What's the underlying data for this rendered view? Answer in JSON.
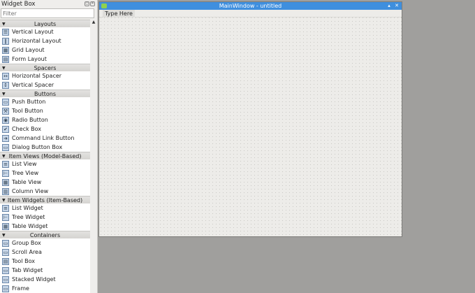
{
  "widget_box": {
    "title": "Widget Box",
    "filter_placeholder": "Filter",
    "sections": [
      {
        "label": "Layouts",
        "items": [
          "Vertical Layout",
          "Horizontal Layout",
          "Grid Layout",
          "Form Layout"
        ]
      },
      {
        "label": "Spacers",
        "items": [
          "Horizontal Spacer",
          "Vertical Spacer"
        ]
      },
      {
        "label": "Buttons",
        "items": [
          "Push Button",
          "Tool Button",
          "Radio Button",
          "Check Box",
          "Command Link Button",
          "Dialog Button Box"
        ]
      },
      {
        "label": "Item Views (Model-Based)",
        "items": [
          "List View",
          "Tree View",
          "Table View",
          "Column View"
        ]
      },
      {
        "label": "Item Widgets (Item-Based)",
        "items": [
          "List Widget",
          "Tree Widget",
          "Table Widget"
        ]
      },
      {
        "label": "Containers",
        "items": [
          "Group Box",
          "Scroll Area",
          "Tool Box",
          "Tab Widget",
          "Stacked Widget",
          "Frame"
        ]
      }
    ]
  },
  "main_window": {
    "title": "MainWindow - untitled",
    "menu_placeholder": "Type Here"
  },
  "colors": {
    "titlebar": "#3f8fde"
  }
}
